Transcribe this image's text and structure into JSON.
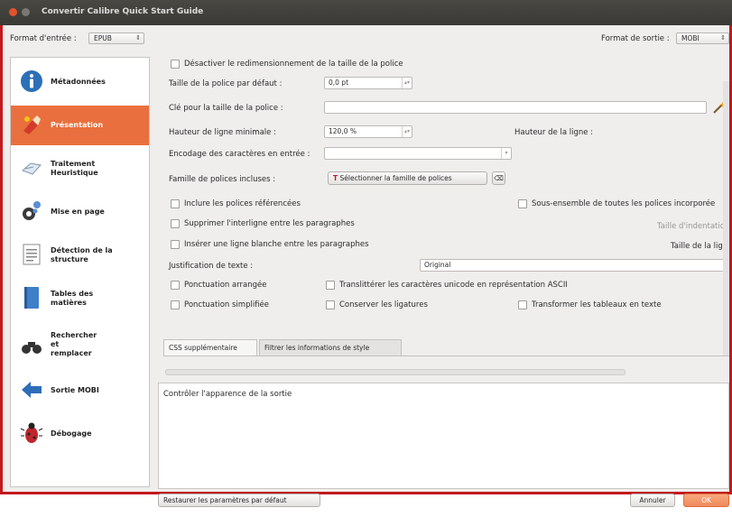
{
  "window": {
    "title": "Convertir Calibre Quick Start Guide",
    "frame_color": "#c3181d",
    "titlebar_buttons": [
      "close-button",
      "minimize-button"
    ]
  },
  "topbar": {
    "input_format_label": "Format d'entrée :",
    "input_format_value": "EPUB",
    "output_format_label": "Format de sortie :",
    "output_format_value": "MOBI"
  },
  "sidebar": {
    "items": [
      {
        "label": "Métadonnées",
        "icon": "info-icon"
      },
      {
        "label": "Présentation",
        "icon": "paint-brush-icon",
        "active": true
      },
      {
        "label": "Traitement Heuristique",
        "icon": "heuristic-icon"
      },
      {
        "label": "Mise en page",
        "icon": "page-setup-icon"
      },
      {
        "label": "Détection de la structure",
        "icon": "structure-icon"
      },
      {
        "label": "Tables des matières",
        "icon": "toc-icon"
      },
      {
        "label": "Rechercher et remplacer",
        "icon": "binoculars-icon"
      },
      {
        "label": "Sortie MOBI",
        "icon": "arrow-left-icon"
      },
      {
        "label": "Débogage",
        "icon": "bug-icon"
      }
    ],
    "active_color": "#e9703e"
  },
  "main": {
    "disable_font_rescale_label": "Désactiver le redimensionnement de la taille de la police",
    "default_font_size_label": "Taille de la police par défaut :",
    "default_font_size_value": "0,0 pt",
    "font_size_key_label": "Clé pour la taille de la police :",
    "font_size_key_value": "",
    "min_line_height_label": "Hauteur de ligne minimale :",
    "min_line_height_value": "120,0 %",
    "line_height_label": "Hauteur de la ligne :",
    "input_encoding_label": "Encodage des caractères en entrée :",
    "input_encoding_value": "",
    "embed_font_family_label": "Famille de polices incluses :",
    "select_font_family_button": "Sélectionner la famille de polices",
    "embed_referenced_fonts": "Inclure les polices référencées",
    "subset_all_fonts": "Sous-ensemble de toutes les polices incorporée",
    "remove_paragraph_spacing": "Supprimer l'interligne entre les paragraphes",
    "indent_size_label": "Taille d'indentatio",
    "insert_blank_line": "Insérer une ligne blanche entre les paragraphes",
    "line_size_label": "Taille de la lig",
    "text_justification_label": "Justification de texte :",
    "text_justification_value": "Original",
    "smarten_punctuation": "Ponctuation arrangée",
    "transliterate_unicode": "Translittérer les caractères unicode en représentation ASCII",
    "unsmarten_punctuation": "Ponctuation simplifiée",
    "keep_ligatures": "Conserver les ligatures",
    "linearize_tables": "Transformer les tableaux en texte",
    "tabs": [
      "CSS supplémentaire",
      "Filtrer les informations de style"
    ]
  },
  "description": {
    "text": "Contrôler l'apparence de la sortie"
  },
  "footer": {
    "restore_defaults": "Restaurer les paramètres par défaut",
    "cancel": "Annuler",
    "ok": "OK"
  }
}
